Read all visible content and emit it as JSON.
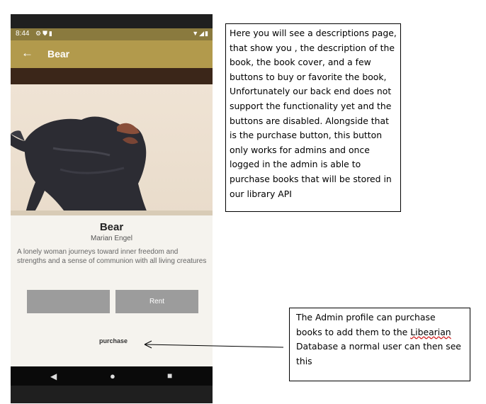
{
  "status_bar": {
    "time": "8:44",
    "left_icons": [
      "gear-icon",
      "shield-icon",
      "clipboard-icon"
    ],
    "right_icons": [
      "wifi-icon",
      "signal-icon",
      "battery-icon"
    ]
  },
  "app_bar": {
    "title": "Bear",
    "back_icon": "arrow-left-icon"
  },
  "book": {
    "title": "Bear",
    "author": "Marian Engel",
    "description": "A lonely woman journeys toward inner freedom and strengths and a sense of communion with all living creatures"
  },
  "buttons": {
    "buy_label": "",
    "rent_label": "Rent",
    "purchase_label": "purchase"
  },
  "nav_bar": {
    "icons": [
      "back-triangle-icon",
      "home-circle-icon",
      "recents-square-icon"
    ]
  },
  "annotations": {
    "top_note": "Here you will see a descriptions page, that show you , the description of the book, the book cover, and a few buttons to buy or favorite the book, Unfortunately our back end does not support the functionality yet and the buttons are disabled. Alongside that is the purchase button, this button only works for admins and once logged in the admin is able to purchase books that will be stored in our library API",
    "bottom_note_part1": "The Admin profile can purchase books to add them to the ",
    "bottom_note_squiggle": "Libearian",
    "bottom_note_part2": " Database a normal user can then see this"
  },
  "colors": {
    "app_bar": "#b29a4c",
    "status_bar": "#8a7a3e",
    "button_disabled": "#9c9c9c",
    "page_bg": "#f5f3ee"
  }
}
